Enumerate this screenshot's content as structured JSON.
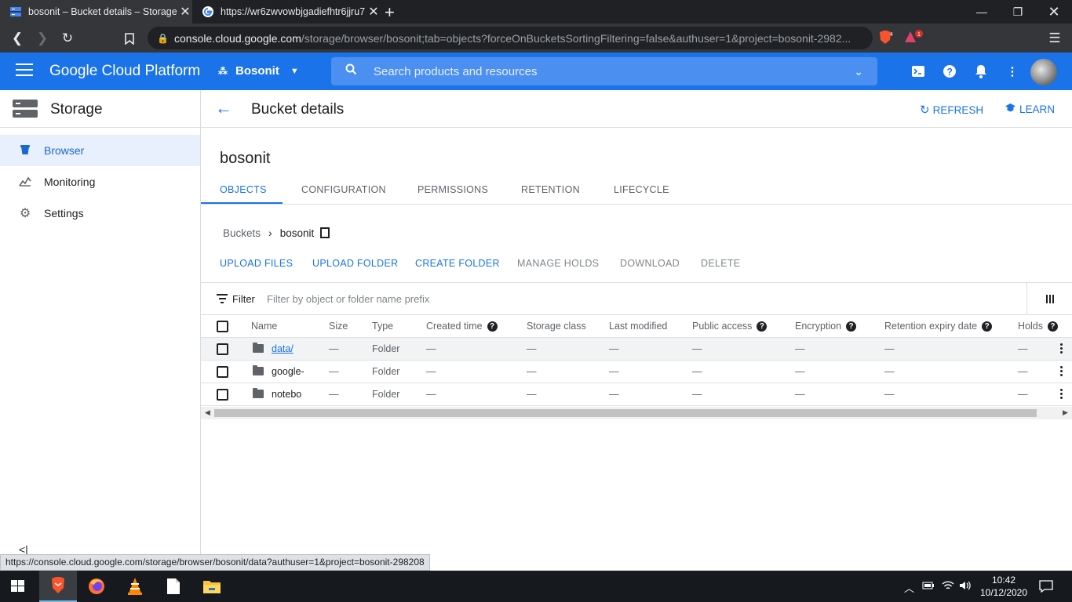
{
  "browser": {
    "tabs": [
      {
        "title": "bosonit – Bucket details – Storage"
      },
      {
        "title": "https://wr6zwvowbjgadiefhtr6jjru7"
      }
    ],
    "url_host": "console.cloud.google.com",
    "url_path": "/storage/browser/bosonit;tab=objects?forceOnBucketsSortingFiltering=false&authuser=1&project=bosonit-2982...",
    "brave_badge": "4",
    "alert_badge": "1",
    "status_url": "https://console.cloud.google.com/storage/browser/bosonit/data?authuser=1&project=bosonit-298208"
  },
  "header": {
    "logo": "Google Cloud Platform",
    "project": "Bosonit",
    "search_placeholder": "Search products and resources"
  },
  "sidebar": {
    "title": "Storage",
    "items": [
      {
        "label": "Browser",
        "icon": "bucket-icon"
      },
      {
        "label": "Monitoring",
        "icon": "chart-icon"
      },
      {
        "label": "Settings",
        "icon": "gear-icon"
      }
    ]
  },
  "page": {
    "title": "Bucket details",
    "refresh": "REFRESH",
    "learn": "LEARN",
    "bucket": "bosonit",
    "tabs": [
      "OBJECTS",
      "CONFIGURATION",
      "PERMISSIONS",
      "RETENTION",
      "LIFECYCLE"
    ],
    "breadcrumb": {
      "root": "Buckets",
      "current": "bosonit"
    },
    "actions": {
      "upload_files": "UPLOAD FILES",
      "upload_folder": "UPLOAD FOLDER",
      "create_folder": "CREATE FOLDER",
      "manage_holds": "MANAGE HOLDS",
      "download": "DOWNLOAD",
      "delete": "DELETE"
    },
    "filter": {
      "label": "Filter",
      "placeholder": "Filter by object or folder name prefix"
    }
  },
  "table": {
    "columns": [
      "Name",
      "Size",
      "Type",
      "Created time",
      "Storage class",
      "Last modified",
      "Public access",
      "Encryption",
      "Retention expiry date",
      "Holds"
    ],
    "rows": [
      {
        "name": "data/",
        "size": "—",
        "type": "Folder",
        "created": "—",
        "storage": "—",
        "modified": "—",
        "public": "—",
        "encryption": "—",
        "retention": "—",
        "holds": "—"
      },
      {
        "name": "google-",
        "size": "—",
        "type": "Folder",
        "created": "—",
        "storage": "—",
        "modified": "—",
        "public": "—",
        "encryption": "—",
        "retention": "—",
        "holds": "—"
      },
      {
        "name": "notebo",
        "size": "—",
        "type": "Folder",
        "created": "—",
        "storage": "—",
        "modified": "—",
        "public": "—",
        "encryption": "—",
        "retention": "—",
        "holds": "—"
      }
    ]
  },
  "taskbar": {
    "time": "10:42",
    "date": "10/12/2020"
  },
  "colors": {
    "brand": "#1a73e8",
    "active_nav_bg": "#e8f0fe"
  }
}
